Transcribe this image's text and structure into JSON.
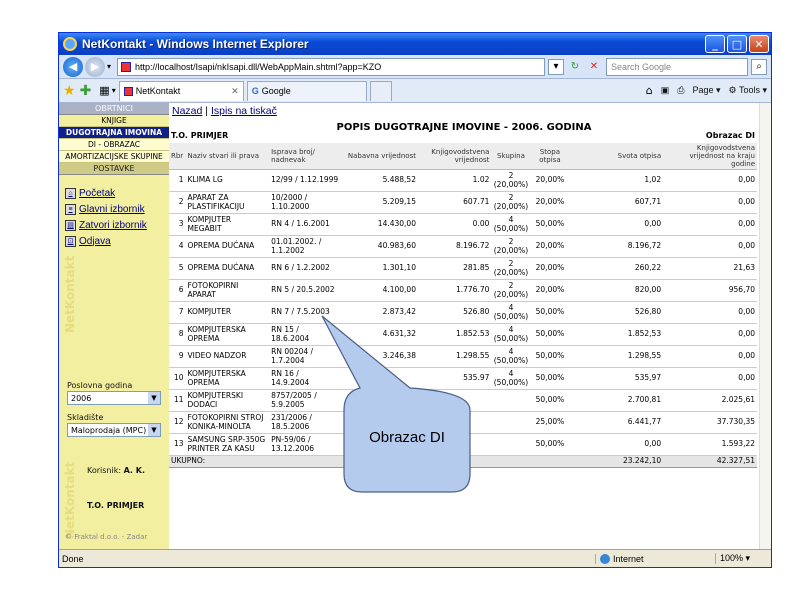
{
  "window": {
    "title": "NetKontakt - Windows Internet Explorer"
  },
  "address": {
    "url": "http://localhost/Isapi/nkIsapi.dll/WebAppMain.shtml?app=KZO",
    "search_placeholder": "Search Google"
  },
  "tabs": [
    {
      "label": "NetKontakt"
    },
    {
      "label": "Google"
    }
  ],
  "commands": {
    "page": "Page",
    "tools": "Tools"
  },
  "sidebar": {
    "header": "OBRTNICI",
    "items": [
      "KNJIGE",
      "DUGOTRAJNA IMOVINA",
      "DI - OBRAZAC",
      "AMORTIZACIJSKE SKUPINE"
    ],
    "postavke": "POSTAVKE",
    "links": [
      "Početak",
      "Glavni izbornik",
      "Zatvori izbornik",
      "Odjava"
    ],
    "brand": "NetKontakt",
    "year_label": "Poslovna godina",
    "year_value": "2006",
    "warehouse_label": "Skladište",
    "warehouse_value": "Maloprodaja (MPC)",
    "user_label": "Korisnik:",
    "user_value": "A. K.",
    "company": "T.O. PRIMJER",
    "copyright": "© Fraktal d.o.o. - Zadar"
  },
  "toplinks": {
    "back": "Nazad",
    "sep": "|",
    "print": "Ispis na tiskač"
  },
  "report": {
    "title": "POPIS DUGOTRAJNE IMOVINE - 2006. GODINA",
    "company": "T.O. PRIMJER",
    "form": "Obrazac DI",
    "columns": [
      "Rbr",
      "Naziv stvari ili prava",
      "Isprava broj/ nadnevak",
      "Nabavna vrijednost",
      "Knjigovodstvena vrijednost",
      "Skupina",
      "Stopa otpisa",
      "Svota otpisa",
      "Knjigovodstvena vrijednost na kraju godine"
    ],
    "rows": [
      [
        "1",
        "KLIMA LG",
        "12/99 / 1.12.1999",
        "5.488,52",
        "1.02",
        "2 (20,00%)",
        "20,00%",
        "1,02",
        "0,00"
      ],
      [
        "2",
        "APARAT ZA PLASTIFIKACIJU",
        "10/2000 / 1.10.2000",
        "5.209,15",
        "607.71",
        "2 (20,00%)",
        "20,00%",
        "607,71",
        "0,00"
      ],
      [
        "3",
        "KOMPJUTER MEGABIT",
        "RN 4 / 1.6.2001",
        "14.430,00",
        "0.00",
        "4 (50,00%)",
        "50,00%",
        "0,00",
        "0,00"
      ],
      [
        "4",
        "OPREMA DUĆANA",
        "01.01.2002. / 1.1.2002",
        "40.983,60",
        "8.196.72",
        "2 (20,00%)",
        "20,00%",
        "8.196,72",
        "0,00"
      ],
      [
        "5",
        "OPREMA DUĆANA",
        "RN 6 / 1.2.2002",
        "1.301,10",
        "281.85",
        "2 (20,00%)",
        "20,00%",
        "260,22",
        "21,63"
      ],
      [
        "6",
        "FOTOKOPIRNI APARAT",
        "RN 5 / 20.5.2002",
        "4.100,00",
        "1.776.70",
        "2 (20,00%)",
        "20,00%",
        "820,00",
        "956,70"
      ],
      [
        "7",
        "KOMPJUTER",
        "RN 7 / 7.5.2003",
        "2.873,42",
        "526.80",
        "4 (50,00%)",
        "50,00%",
        "526,80",
        "0,00"
      ],
      [
        "8",
        "KOMPJUTERSKA OPREMA",
        "RN 15 / 18.6.2004",
        "4.631,32",
        "1.852.53",
        "4 (50,00%)",
        "50,00%",
        "1.852,53",
        "0,00"
      ],
      [
        "9",
        "VIDEO NADZOR",
        "RN 00204 / 1.7.2004",
        "3.246,38",
        "1.298.55",
        "4 (50,00%)",
        "50,00%",
        "1.298,55",
        "0,00"
      ],
      [
        "10",
        "KOMPJUTERSKA OPREMA",
        "RN 16 / 14.9.2004",
        "",
        "535.97",
        "4 (50,00%)",
        "50,00%",
        "535,97",
        "0,00"
      ],
      [
        "11",
        "KOMPJUTERSKI DODACI",
        "8757/2005 / 5.9.2005",
        "",
        "",
        "",
        "50,00%",
        "2.700,81",
        "2.025,61"
      ],
      [
        "12",
        "FOTOKOPIRNI STROJ KONIKA-MINOLTA",
        "231/2006 / 18.5.2006",
        "",
        "",
        "",
        "25,00%",
        "6.441,77",
        "37.730,35"
      ],
      [
        "13",
        "SAMSUNG SRP-350G PRINTER ZA KASU",
        "PN-59/06 / 13.12.2006",
        "",
        "",
        "",
        "50,00%",
        "0,00",
        "1.593,22"
      ]
    ],
    "total_label": "UKUPNO:",
    "total_otpis": "23.242,10",
    "total_kraj": "42.327,51"
  },
  "callout": {
    "text": "Obrazac DI"
  },
  "status": {
    "left": "Done",
    "zone": "Internet",
    "zoom": "100%"
  }
}
